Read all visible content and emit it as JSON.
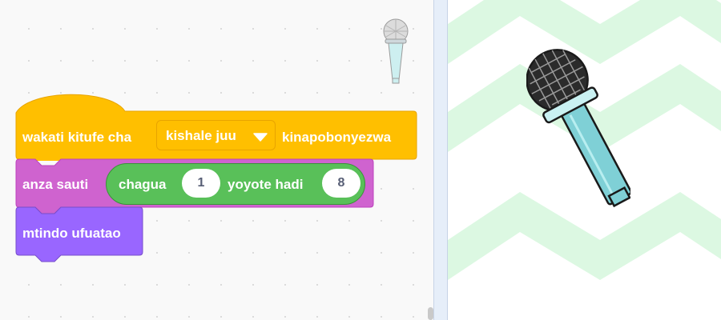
{
  "event_block": {
    "prefix": "wakati kitufe cha",
    "dropdown_value": "kishale juu",
    "suffix": "kinapobonyezwa"
  },
  "sound_block": {
    "label": "anza sauti",
    "operator": {
      "label": "chagua",
      "from_value": "1",
      "middle_label": "yoyote hadi",
      "to_value": "8"
    }
  },
  "looks_block": {
    "label": "mtindo ufuatao"
  },
  "colors": {
    "events": "#ffbf00",
    "sound": "#cf63cf",
    "operators": "#59c059",
    "looks": "#9966ff",
    "stage_chevrons": "#dcf8e2",
    "microphone_body": "#7fd0d6"
  },
  "icons": {
    "sprite_thumbnail": "microphone-icon",
    "dropdown_caret": "caret-down-icon",
    "stage_sprite": "microphone-sprite"
  }
}
